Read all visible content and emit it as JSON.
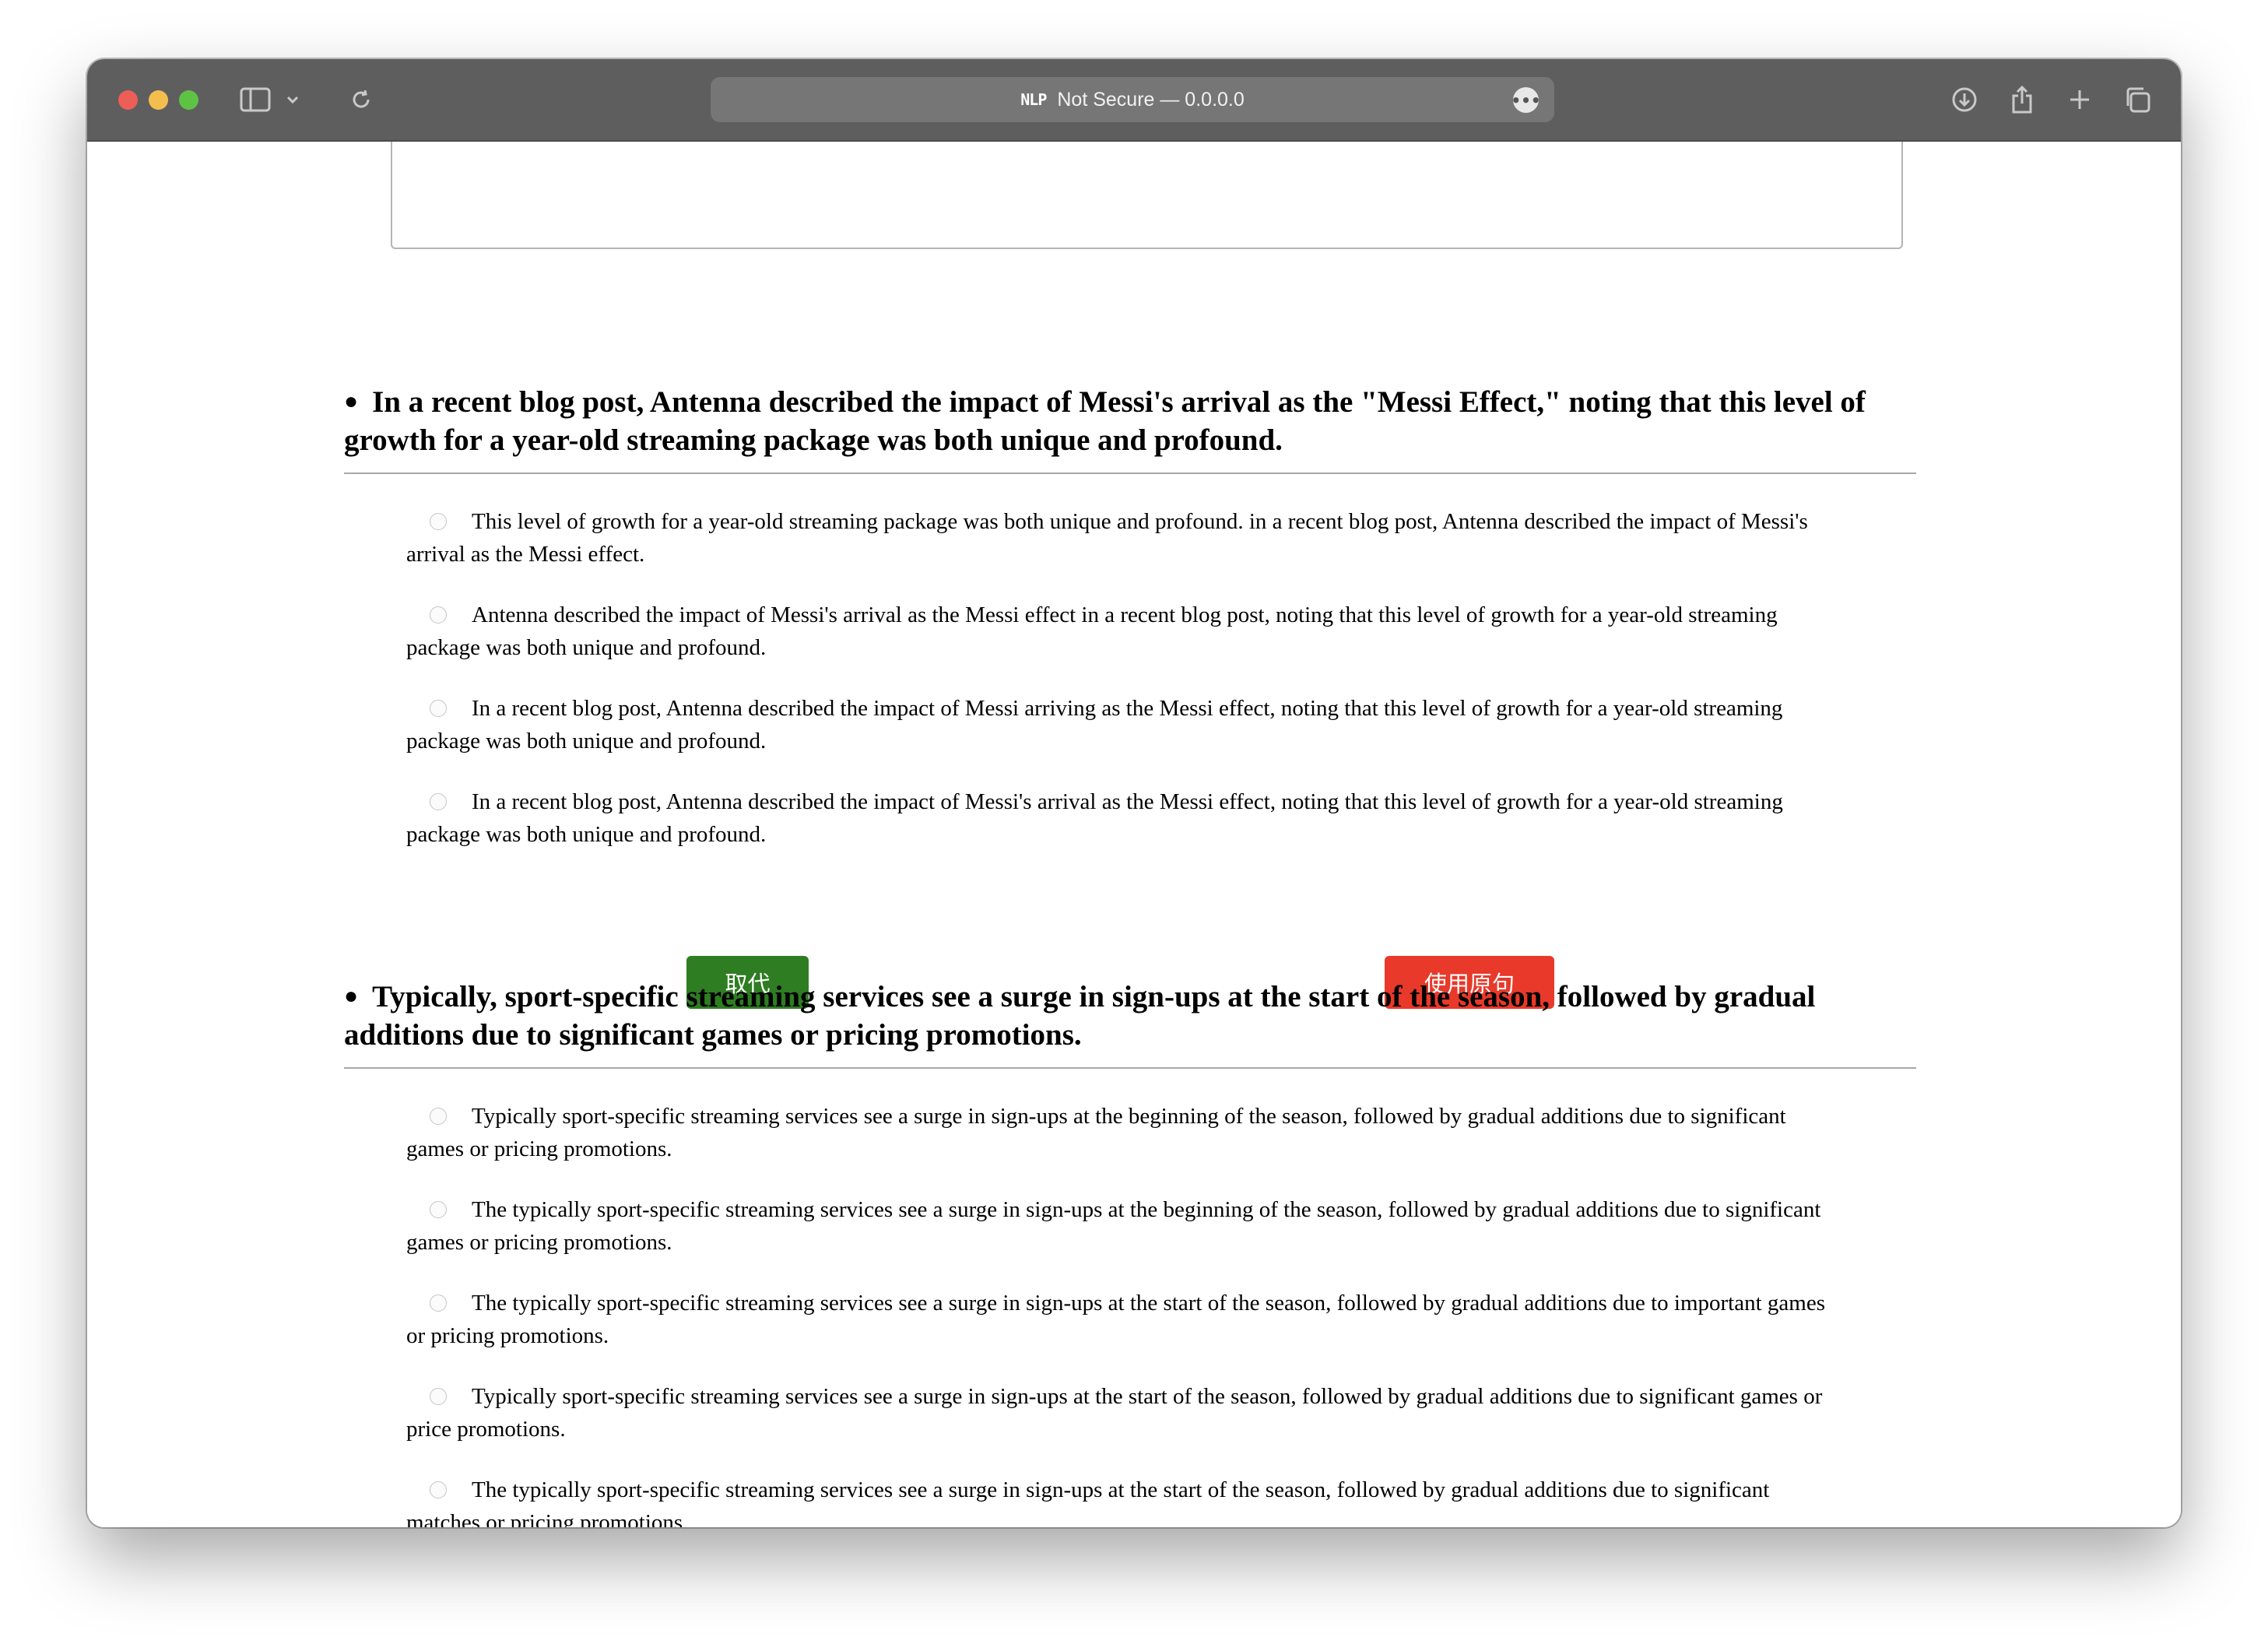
{
  "browser": {
    "address_badge": "NLP",
    "address_text": "Not Secure — 0.0.0.0",
    "more_glyph": "•••"
  },
  "questions": [
    {
      "title": "In a recent blog post, Antenna described the impact of Messi's arrival as the \"Messi Effect,\" noting that this level of growth for a year-old streaming package was both unique and profound.",
      "options": [
        "This level of growth for a year-old streaming package was both unique and profound. in a recent blog post, Antenna described the impact of Messi's arrival as the Messi effect.",
        "Antenna described the impact of Messi's arrival as the Messi effect in a recent blog post, noting that this level of growth for a year-old streaming package was both unique and profound.",
        "In a recent blog post, Antenna described the impact of Messi arriving as the Messi effect, noting that this level of growth for a year-old streaming package was both unique and profound.",
        "In a recent blog post, Antenna described the impact of Messi's arrival as the Messi effect, noting that this level of growth for a year-old streaming package was both unique and profound."
      ],
      "replace_label": "取代",
      "use_original_label": "使用原句"
    },
    {
      "title": "Typically, sport-specific streaming services see a surge in sign-ups at the start of the season, followed by gradual additions due to significant games or pricing promotions.",
      "options": [
        "Typically sport-specific streaming services see a surge in sign-ups at the beginning of the season, followed by gradual additions due to significant games or pricing promotions.",
        "The typically sport-specific streaming services see a surge in sign-ups at the beginning of the season, followed by gradual additions due to significant games or pricing promotions.",
        "The typically sport-specific streaming services see a surge in sign-ups at the start of the season, followed by gradual additions due to important games or pricing promotions.",
        "Typically sport-specific streaming services see a surge in sign-ups at the start of the season, followed by gradual additions due to significant games or price promotions.",
        "The typically sport-specific streaming services see a surge in sign-ups at the start of the season, followed by gradual additions due to significant matches or pricing promotions."
      ]
    }
  ]
}
